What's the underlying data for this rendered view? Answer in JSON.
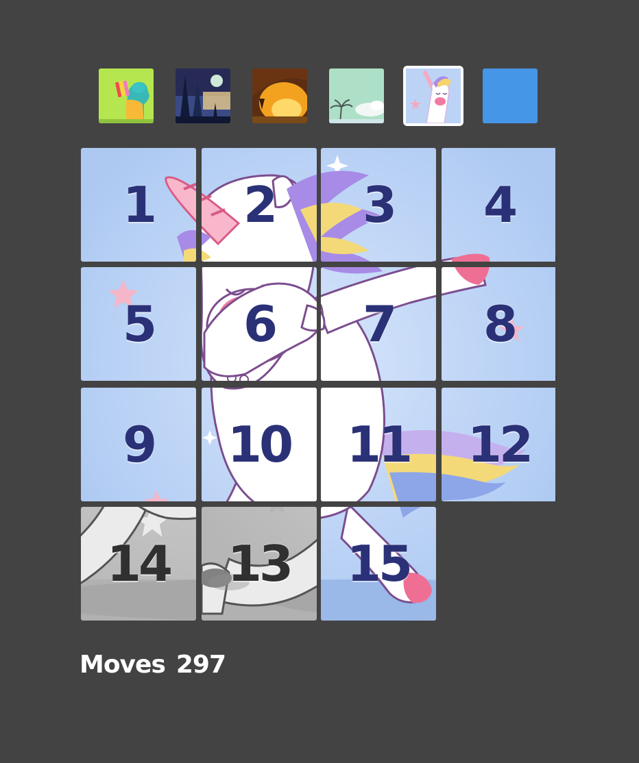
{
  "thumbnails": [
    {
      "name": "thumb-llama",
      "selected": false
    },
    {
      "name": "thumb-night-forest",
      "selected": false
    },
    {
      "name": "thumb-sunset-cave",
      "selected": false
    },
    {
      "name": "thumb-beach-palm",
      "selected": false
    },
    {
      "name": "thumb-unicorn",
      "selected": true
    },
    {
      "name": "thumb-plain-blue",
      "selected": false,
      "color": "#4596e6"
    }
  ],
  "tiles": [
    "1",
    "2",
    "3",
    "4",
    "5",
    "6",
    "7",
    "8",
    "9",
    "10",
    "11",
    "12",
    "14",
    "13",
    "15"
  ],
  "moves": {
    "label": "Moves",
    "count": "297"
  },
  "colors": {
    "background": "#434343",
    "number": "#2b3177",
    "tile_sky": "#b9d2f5",
    "selected_border": "#ffffff",
    "blue_tile": "#4596e6"
  }
}
